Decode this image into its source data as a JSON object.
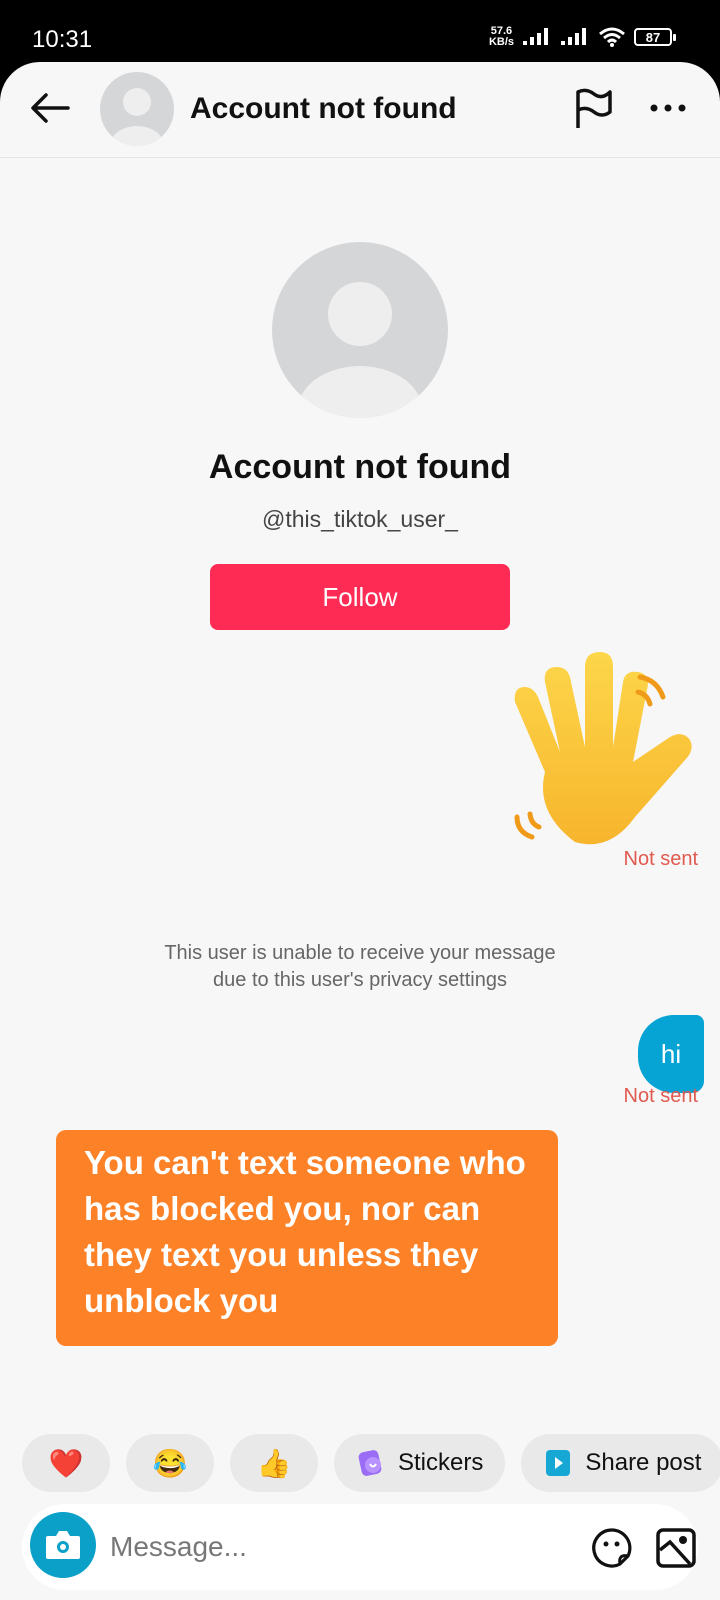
{
  "status_bar": {
    "time": "10:31",
    "net_speed_value": "57.6",
    "net_speed_unit": "KB/s",
    "battery": "87"
  },
  "header": {
    "title": "Account not found",
    "icons": [
      "back-arrow-icon",
      "default-avatar-icon",
      "flag-icon",
      "more-icon"
    ]
  },
  "profile": {
    "name": "Account not found",
    "handle": "@this_tiktok_user_",
    "follow_label": "Follow",
    "follow_color": "#fe2c55"
  },
  "messages": [
    {
      "type": "emoji",
      "content": "waving-hand",
      "status": "Not sent"
    },
    {
      "type": "system",
      "line1": "This user is unable to receive your message",
      "line2": "due to this user's privacy settings"
    },
    {
      "type": "text",
      "content": "hi",
      "status": "Not sent",
      "bubble_color": "#05a4d4"
    }
  ],
  "overlay_caption": {
    "text": "You can't text someone who has blocked you, nor can they text you unless they unblock you",
    "color": "#fc8127"
  },
  "quick_replies": [
    {
      "icon": "heart-emoji",
      "glyph": "❤️"
    },
    {
      "icon": "laughing-emoji",
      "glyph": "😂"
    },
    {
      "icon": "thumbs-up-emoji",
      "glyph": "👍"
    },
    {
      "icon": "stickers-icon",
      "label": "Stickers"
    },
    {
      "icon": "share-post-icon",
      "label": "Share post"
    }
  ],
  "composer": {
    "placeholder": "Message...",
    "value": ""
  },
  "colors": {
    "not_sent": "#e05a50",
    "camera_button": "#0aa0c8"
  }
}
